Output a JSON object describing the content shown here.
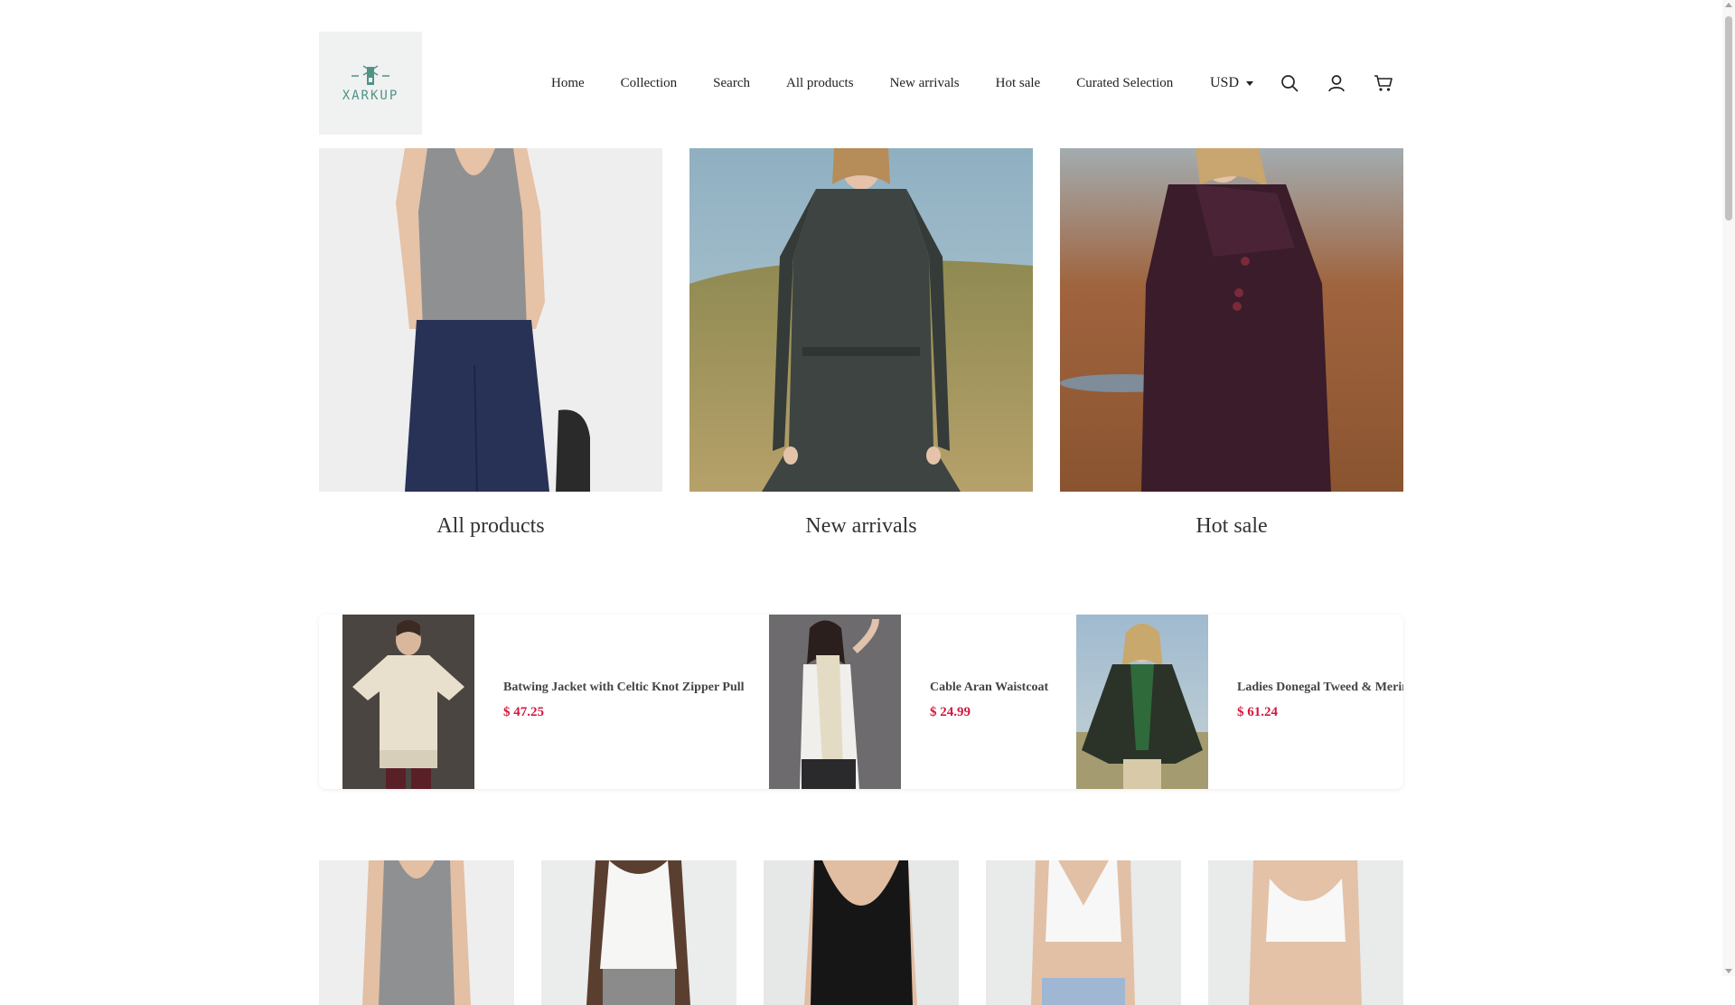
{
  "brand": {
    "name": "XARKUP",
    "logo_icon": "windmill-logo-icon"
  },
  "nav": {
    "items": [
      {
        "label": "Home"
      },
      {
        "label": "Collection"
      },
      {
        "label": "Search"
      },
      {
        "label": "All products"
      },
      {
        "label": "New arrivals"
      },
      {
        "label": "Hot sale"
      },
      {
        "label": "Curated Selection"
      }
    ]
  },
  "header_tools": {
    "currency": "USD",
    "icons": [
      "search-icon",
      "account-icon",
      "cart-icon"
    ]
  },
  "collections": [
    {
      "title": "All products"
    },
    {
      "title": "New arrivals"
    },
    {
      "title": "Hot sale"
    }
  ],
  "featured_products": [
    {
      "name": "Batwing Jacket with Celtic Knot Zipper Pull",
      "price": "$ 47.25"
    },
    {
      "name": "Cable Aran Waistcoat",
      "price": "$ 24.99"
    },
    {
      "name": "Ladies Donegal Tweed & Merino",
      "price": "$ 61.24"
    }
  ],
  "colors": {
    "price": "#d2193f",
    "logo_text": "#4f9387",
    "logo_bg": "#f0f1f1"
  }
}
